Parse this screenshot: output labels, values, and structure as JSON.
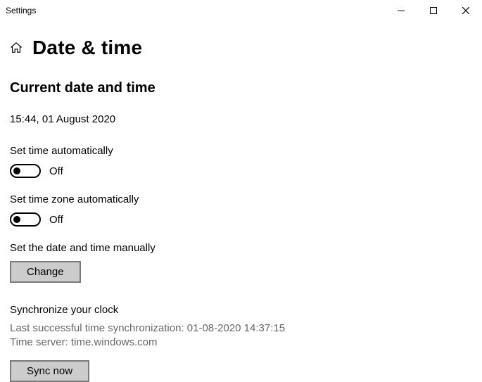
{
  "window": {
    "title": "Settings"
  },
  "page": {
    "title": "Date & time"
  },
  "current": {
    "heading": "Current date and time",
    "value": "15:44, 01 August 2020"
  },
  "settings": {
    "auto_time": {
      "label": "Set time automatically",
      "state": "Off"
    },
    "auto_tz": {
      "label": "Set time zone automatically",
      "state": "Off"
    },
    "manual": {
      "label": "Set the date and time manually",
      "button": "Change"
    }
  },
  "sync": {
    "heading": "Synchronize your clock",
    "last_sync": "Last successful time synchronization: 01-08-2020 14:37:15",
    "server": "Time server: time.windows.com",
    "button": "Sync now"
  }
}
